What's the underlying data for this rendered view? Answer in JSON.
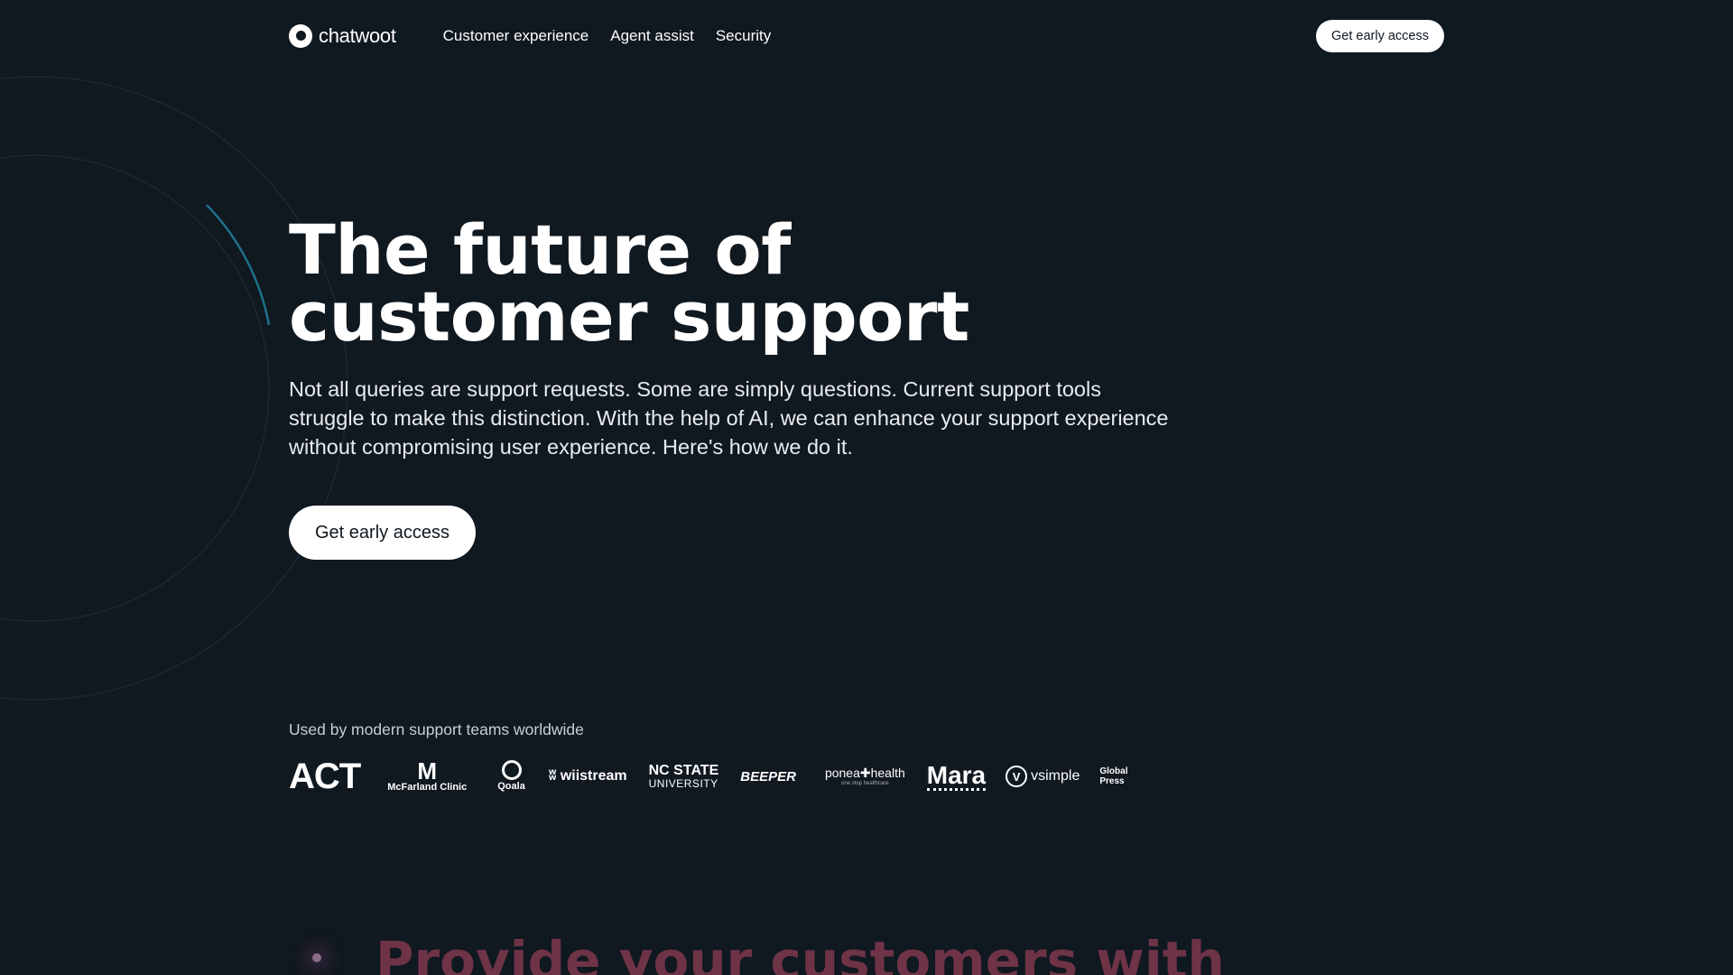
{
  "nav": {
    "brand": "chatwoot",
    "links": [
      "Customer experience",
      "Agent assist",
      "Security"
    ],
    "cta": "Get early access"
  },
  "hero": {
    "title_line1": "The future of",
    "title_line2": "customer support",
    "subtitle": "Not all queries are support requests. Some are simply questions. Current support tools struggle to make this distinction. With the help of AI, we can enhance your support experience without compromising user experience. Here's how we do it.",
    "cta": "Get early access"
  },
  "logos": {
    "caption": "Used by modern support teams worldwide",
    "act": "ACT",
    "mcfarland_mark": "M",
    "mcfarland": "McFarland Clinic",
    "qoala": "Qoala",
    "wiistream": "wiistream",
    "ncstate_a": "NC STATE",
    "ncstate_b": "UNIVERSITY",
    "beeper": "BEEPER",
    "ponea_a": "ponea✚health",
    "ponea_b": "one stop healthcare",
    "mara": "Mara",
    "vsimple_mark": "V",
    "vsimple": "vsimple",
    "globalpress_a": "Global",
    "globalpress_b": "Press"
  },
  "next_section": {
    "heading": "Provide your customers with"
  },
  "colors": {
    "background": "#101820",
    "accent_line": "#1f6f8a",
    "next_heading": "#6e3346"
  }
}
